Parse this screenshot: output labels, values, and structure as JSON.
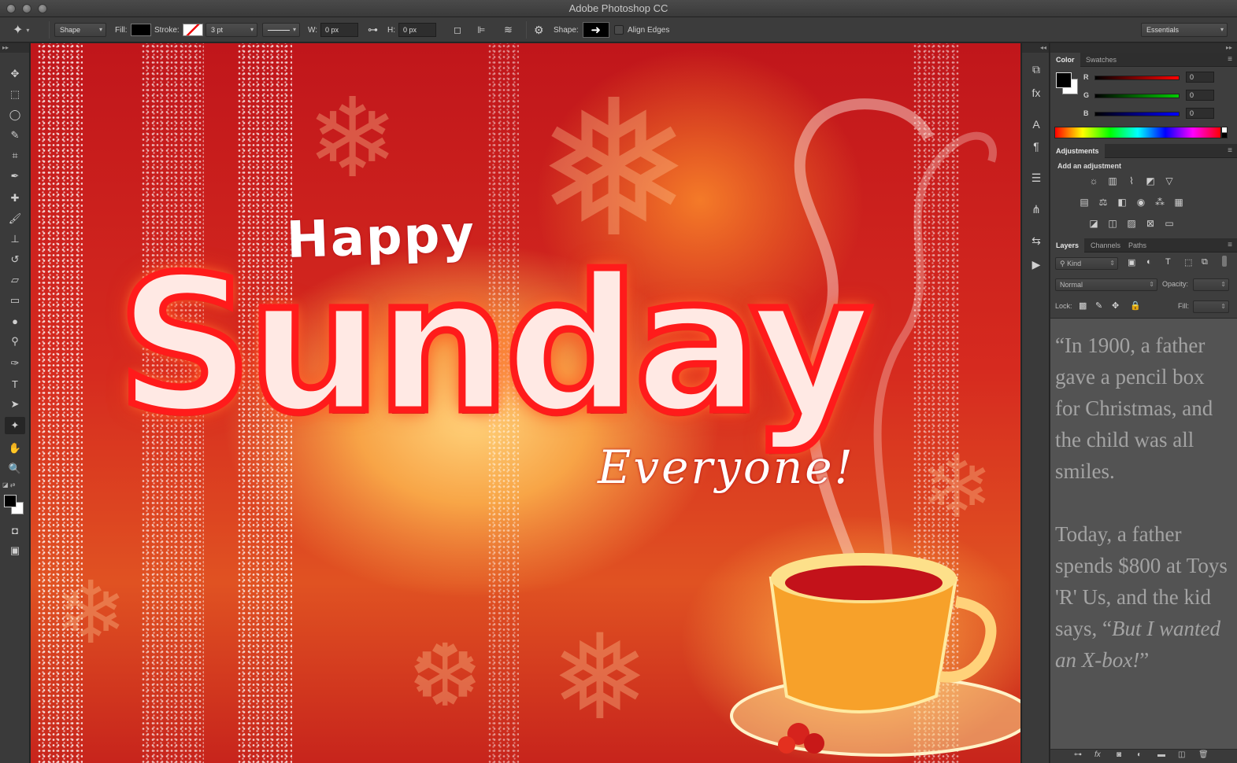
{
  "window": {
    "title": "Adobe Photoshop CC"
  },
  "options_bar": {
    "mode": "Shape",
    "fill_label": "Fill:",
    "stroke_label": "Stroke:",
    "stroke_width": "3 pt",
    "w_label": "W:",
    "w_value": "0 px",
    "h_label": "H:",
    "h_value": "0 px",
    "shape_label": "Shape:",
    "align_edges": "Align Edges",
    "workspace": "Essentials"
  },
  "canvas": {
    "line1": "Happy",
    "line2": "Sunday",
    "line3": "Everyone!"
  },
  "color_panel": {
    "tabs": [
      "Color",
      "Swatches"
    ],
    "channels": [
      {
        "label": "R",
        "value": "0"
      },
      {
        "label": "G",
        "value": "0"
      },
      {
        "label": "B",
        "value": "0"
      }
    ]
  },
  "adjustments_panel": {
    "tab": "Adjustments",
    "heading": "Add an adjustment"
  },
  "layers_panel": {
    "tabs": [
      "Layers",
      "Channels",
      "Paths"
    ],
    "filter": "Kind",
    "blend_mode": "Normal",
    "opacity_label": "Opacity:",
    "lock_label": "Lock:",
    "fill_label": "Fill:",
    "quote_p1": "“In 1900, a father gave a pencil box for Christmas, and the child was all smiles.",
    "quote_p2_pre": "Today, a father spends $800 at Toys 'R' Us, and the kid says, “",
    "quote_p2_em": "But I wanted an X-box!",
    "quote_p2_post": "”"
  }
}
